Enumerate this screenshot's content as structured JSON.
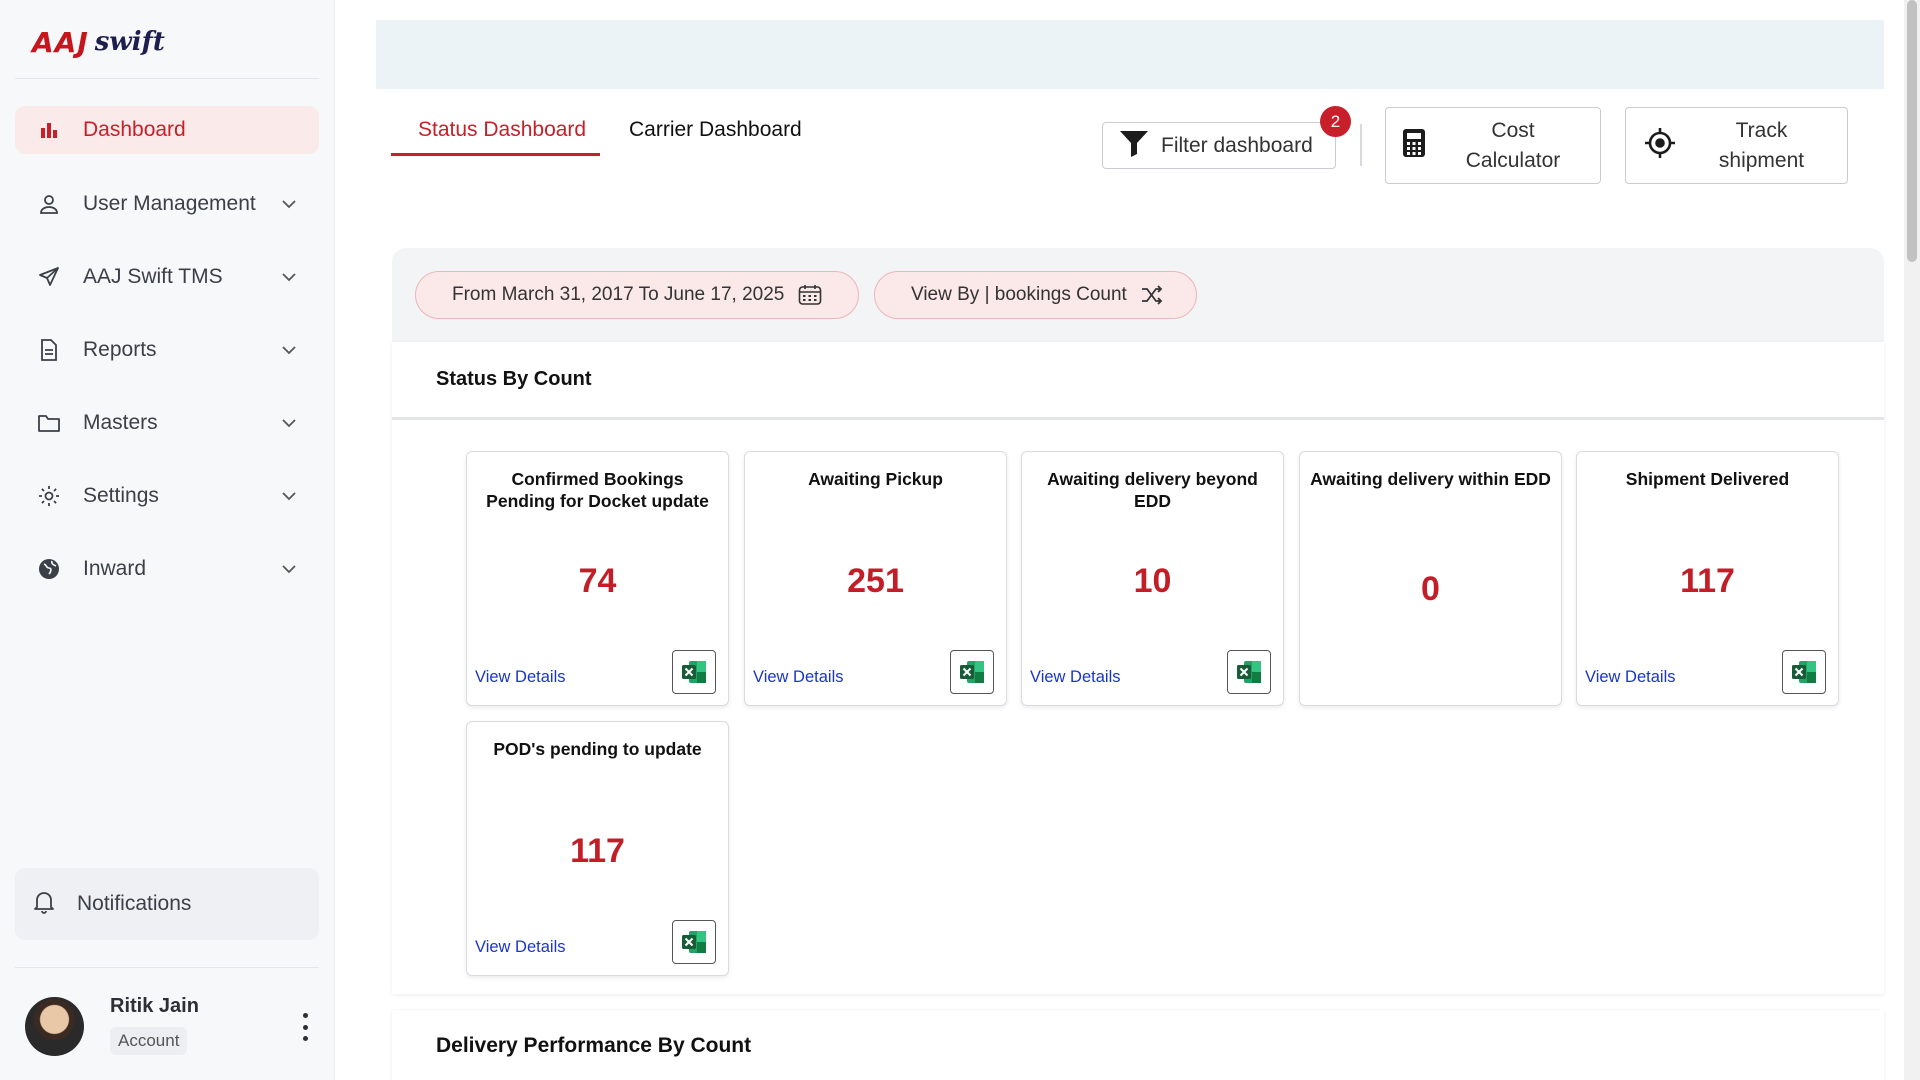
{
  "brand": {
    "logo_text": "AAJ",
    "logo_script": "swift"
  },
  "sidebar": {
    "items": [
      {
        "label": "Dashboard",
        "icon": "bar-chart-icon",
        "active": true
      },
      {
        "label": "User Management",
        "icon": "user-icon"
      },
      {
        "label": "AAJ Swift TMS",
        "icon": "paper-plane-icon"
      },
      {
        "label": "Reports",
        "icon": "document-icon"
      },
      {
        "label": "Masters",
        "icon": "folder-icon"
      },
      {
        "label": "Settings",
        "icon": "gear-icon"
      },
      {
        "label": "Inward",
        "icon": "globe-icon"
      }
    ],
    "notifications_label": "Notifications",
    "user": {
      "name": "Ritik Jain",
      "role": "Account"
    }
  },
  "tabs": [
    {
      "label": "Status Dashboard",
      "active": true
    },
    {
      "label": "Carrier Dashboard",
      "active": false
    }
  ],
  "toolbar": {
    "filter_label": "Filter dashboard",
    "filter_badge": "2",
    "cost_line1": "Cost",
    "cost_line2": "Calculator",
    "track_line1": "Track",
    "track_line2": "shipment"
  },
  "filters": {
    "date_range": "From March 31, 2017 To June 17, 2025",
    "view_by": "View By | bookings Count"
  },
  "status_panel": {
    "title": "Status By Count",
    "link_label": "View Details",
    "cards": [
      {
        "title": "Confirmed Bookings Pending for Docket update",
        "value": "74",
        "has_details": true
      },
      {
        "title": "Awaiting Pickup",
        "value": "251",
        "has_details": true
      },
      {
        "title": "Awaiting delivery beyond EDD",
        "value": "10",
        "has_details": true
      },
      {
        "title": "Awaiting delivery within EDD",
        "value": "0",
        "has_details": false
      },
      {
        "title": "Shipment Delivered",
        "value": "117",
        "has_details": true
      },
      {
        "title": "POD's pending to update",
        "value": "117",
        "has_details": true
      }
    ]
  },
  "delivery_panel": {
    "title": "Delivery Performance By Count"
  },
  "colors": {
    "accent": "#c8202a",
    "link": "#1a35c9",
    "excel_green": "#1d7a45"
  }
}
